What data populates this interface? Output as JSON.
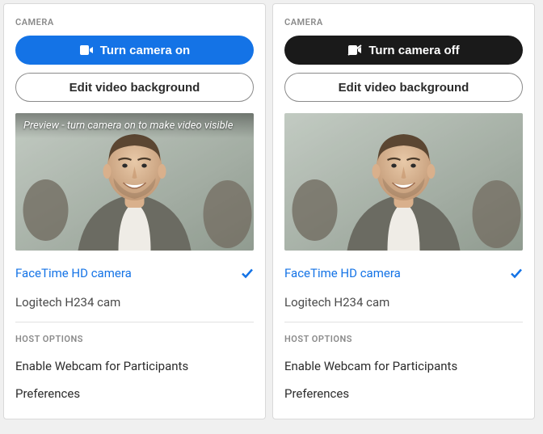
{
  "panels": [
    {
      "heading": "CAMERA",
      "toggle_label": "Turn camera on",
      "toggle_style": "blue",
      "edit_bg_label": "Edit video background",
      "preview_overlay": "Preview -  turn camera on to make video visible",
      "show_overlay": true,
      "cameras": [
        {
          "label": "FaceTime HD camera",
          "selected": true
        },
        {
          "label": "Logitech H234 cam",
          "selected": false
        }
      ],
      "host_heading": "HOST OPTIONS",
      "host_options": [
        "Enable Webcam for Participants",
        "Preferences"
      ]
    },
    {
      "heading": "CAMERA",
      "toggle_label": "Turn camera off",
      "toggle_style": "dark",
      "edit_bg_label": "Edit video background",
      "preview_overlay": "",
      "show_overlay": false,
      "cameras": [
        {
          "label": "FaceTime HD camera",
          "selected": true
        },
        {
          "label": "Logitech H234 cam",
          "selected": false
        }
      ],
      "host_heading": "HOST OPTIONS",
      "host_options": [
        "Enable Webcam for Participants",
        "Preferences"
      ]
    }
  ]
}
